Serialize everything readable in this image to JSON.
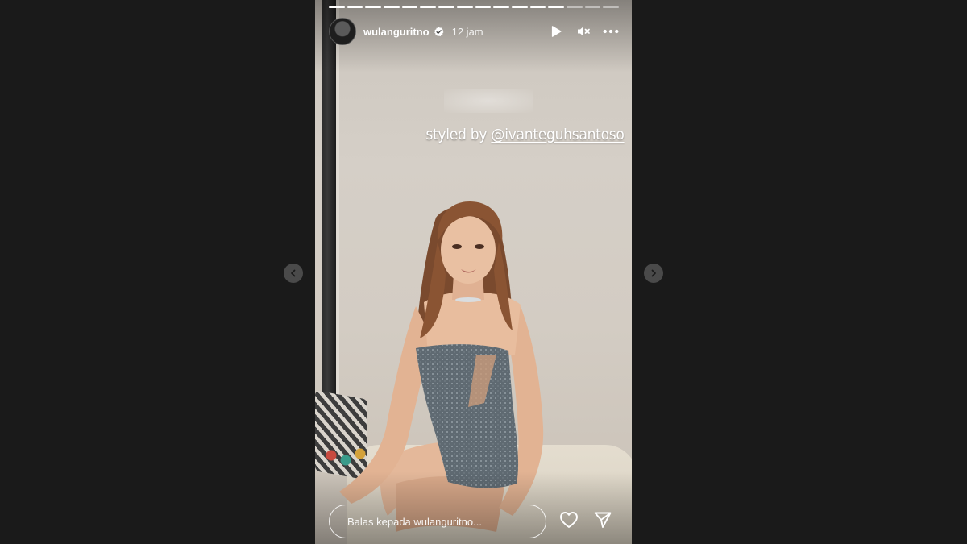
{
  "story": {
    "progress": {
      "total_segments": 16,
      "completed_segments": 13
    },
    "author": {
      "username": "wulanguritno",
      "verified": true,
      "time_ago": "12 jam"
    },
    "controls": {
      "play_icon": "play-icon",
      "mute_icon": "speaker-muted-icon",
      "more_icon": "more-horizontal-icon"
    },
    "sticker": {
      "prefix": "styled by",
      "mention": "@ivanteguhsantoso"
    },
    "reply": {
      "placeholder": "Balas kepada wulanguritno..."
    },
    "actions": {
      "like_icon": "heart-icon",
      "share_icon": "send-icon"
    }
  },
  "navigation": {
    "prev_icon": "chevron-left-icon",
    "next_icon": "chevron-right-icon"
  },
  "colors": {
    "background": "#1a1a1a",
    "text": "#ffffff",
    "nav_button": "#4a4a4a"
  }
}
